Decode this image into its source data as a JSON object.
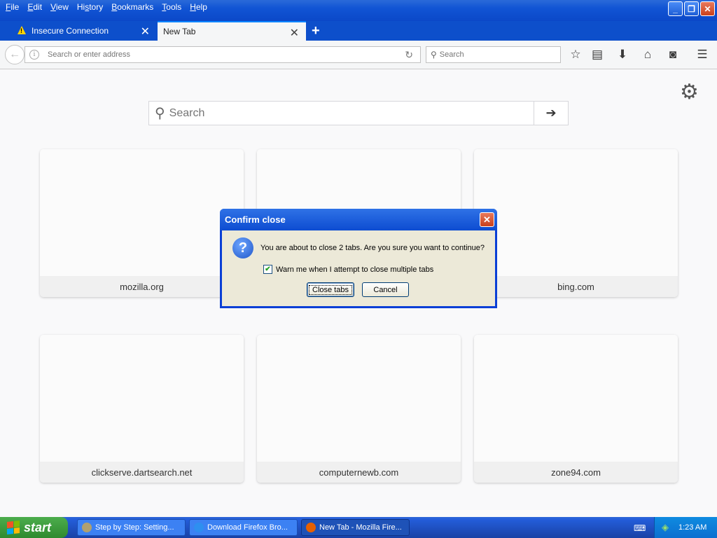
{
  "menubar": {
    "items": [
      "File",
      "Edit",
      "View",
      "History",
      "Bookmarks",
      "Tools",
      "Help"
    ],
    "accelerators": [
      "F",
      "E",
      "V",
      "s",
      "B",
      "T",
      "H"
    ]
  },
  "tabs": [
    {
      "label": "Insecure Connection",
      "icon": "warning-icon"
    },
    {
      "label": "New Tab"
    }
  ],
  "navbar": {
    "url_placeholder": "Search or enter address",
    "search_placeholder": "Search"
  },
  "content": {
    "search_placeholder": "Search",
    "tiles": [
      "mozilla.org",
      "",
      "bing.com",
      "clickserve.dartsearch.net",
      "computernewb.com",
      "zone94.com"
    ]
  },
  "dialog": {
    "title": "Confirm close",
    "message": "You are about to close 2 tabs. Are you sure you want to continue?",
    "checkbox_label": "Warn me when I attempt to close multiple tabs",
    "checkbox_checked": true,
    "primary_button": "Close tabs",
    "cancel_button": "Cancel"
  },
  "taskbar": {
    "start_label": "start",
    "tasks": [
      {
        "label": "Step by Step: Setting..."
      },
      {
        "label": "Download Firefox Bro..."
      },
      {
        "label": "New Tab - Mozilla Fire...",
        "active": true
      }
    ],
    "clock": "1:23 AM"
  },
  "colors": {
    "titlebar": "#0b48c8",
    "dialog_bg": "#ece9d8",
    "start_green": "#2f8a2f"
  }
}
